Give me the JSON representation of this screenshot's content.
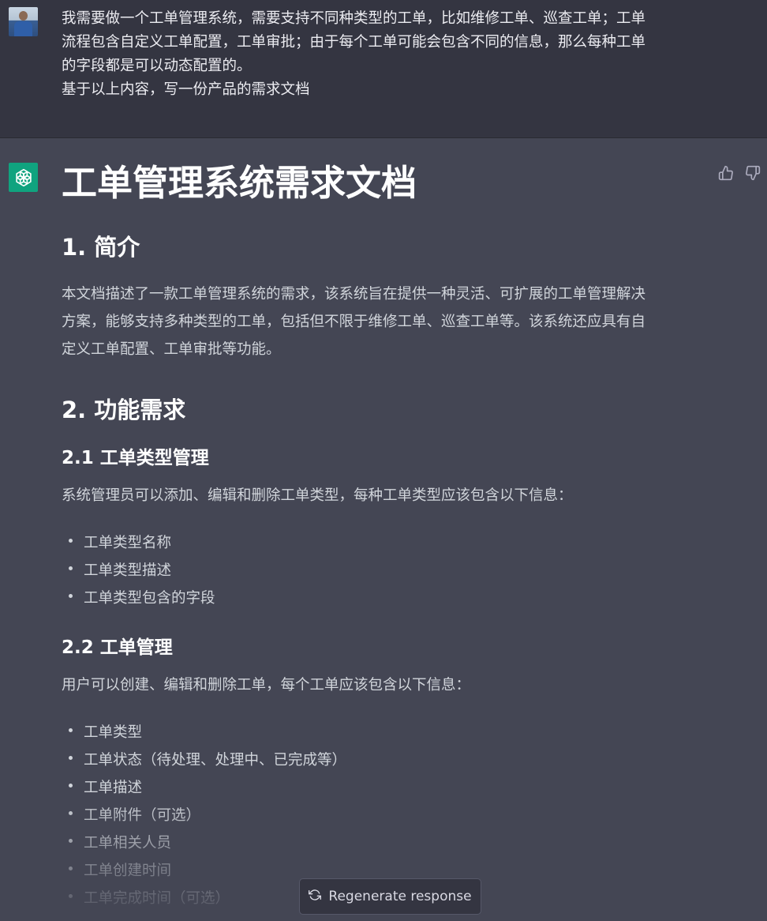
{
  "user_message": {
    "lines": [
      "我需要做一个工单管理系统，需要支持不同种类型的工单，比如维修工单、巡查工单；工单",
      "流程包含自定义工单配置，工单审批；由于每个工单可能会包含不同的信息，那么每种工单",
      "的字段都是可以动态配置的。",
      "基于以上内容，写一份产品的需求文档"
    ]
  },
  "assistant": {
    "title": "工单管理系统需求文档",
    "sections": {
      "intro": {
        "heading": "1. 简介",
        "lines": [
          "本文档描述了一款工单管理系统的需求，该系统旨在提供一种灵活、可扩展的工单管理解决",
          "方案，能够支持多种类型的工单，包括但不限于维修工单、巡查工单等。该系统还应具有自",
          "定义工单配置、工单审批等功能。"
        ]
      },
      "functional": {
        "heading": "2. 功能需求",
        "type_mgmt": {
          "heading": "2.1 工单类型管理",
          "desc": "系统管理员可以添加、编辑和删除工单类型，每种工单类型应该包含以下信息：",
          "items": [
            "工单类型名称",
            "工单类型描述",
            "工单类型包含的字段"
          ]
        },
        "order_mgmt": {
          "heading": "2.2 工单管理",
          "desc": "用户可以创建、编辑和删除工单，每个工单应该包含以下信息：",
          "items": [
            "工单类型",
            "工单状态（待处理、处理中、已完成等）",
            "工单描述",
            "工单附件（可选）",
            "工单相关人员",
            "工单创建时间",
            "工单完成时间（可选）"
          ]
        }
      }
    }
  },
  "actions": {
    "regenerate_label": "Regenerate response"
  },
  "icons": {
    "user_avatar": "user-avatar",
    "assistant_avatar": "openai-logo-icon",
    "thumbs_up": "thumbs-up-icon",
    "thumbs_down": "thumbs-down-icon",
    "regenerate": "refresh-icon"
  },
  "colors": {
    "user_bg": "#343541",
    "assistant_bg": "#444654",
    "gpt_green": "#10a37f"
  }
}
